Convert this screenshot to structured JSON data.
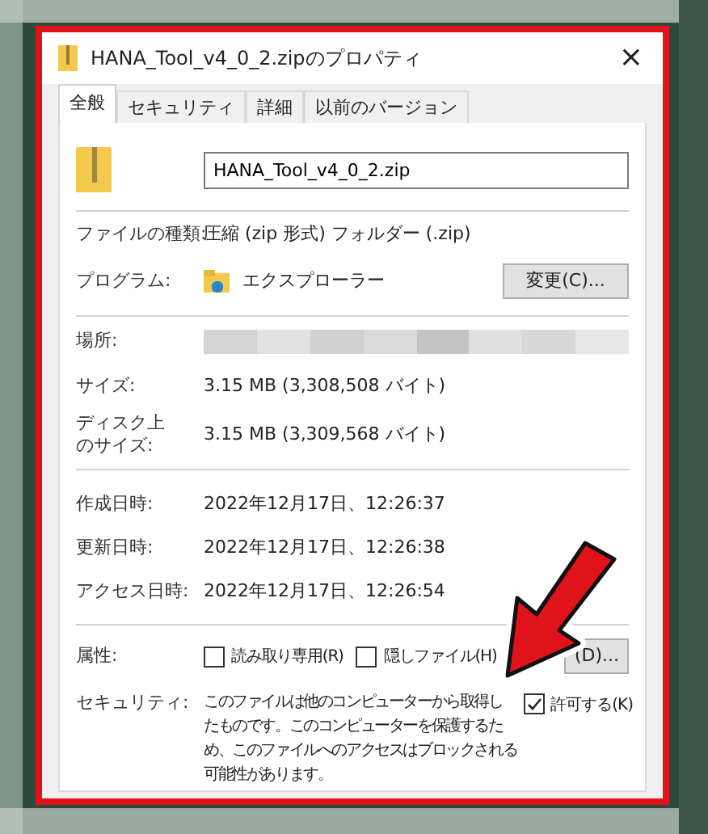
{
  "window": {
    "title": "HANA_Tool_v4_0_2.zipのプロパティ",
    "close": "×"
  },
  "tabs": [
    {
      "label": "全般",
      "selected": true
    },
    {
      "label": "セキュリティ",
      "selected": false
    },
    {
      "label": "詳細",
      "selected": false
    },
    {
      "label": "以前のバージョン",
      "selected": false
    }
  ],
  "file_name": "HANA_Tool_v4_0_2.zip",
  "file_type": {
    "label": "ファイルの種類:",
    "value": "圧縮 (zip 形式) フォルダー (.zip)"
  },
  "program": {
    "label": "プログラム:",
    "value": "エクスプローラー",
    "button": "変更(C)..."
  },
  "location": {
    "label": "場所:",
    "redacted": true
  },
  "size": {
    "label": "サイズ:",
    "value": "3.15 MB (3,308,508 バイト)"
  },
  "disk_size": {
    "label_lines": [
      "ディスク上",
      "のサイズ:"
    ],
    "value": "3.15 MB (3,309,568 バイト)"
  },
  "dates": [
    {
      "label": "作成日時:",
      "value": "2022年12月17日、12:26:37"
    },
    {
      "label": "更新日時:",
      "value": "2022年12月17日、12:26:38"
    },
    {
      "label": "アクセス日時:",
      "value": "2022年12月17日、12:26:54"
    }
  ],
  "attributes": {
    "label": "属性:",
    "options": [
      {
        "label": "読み取り専用(R)",
        "checked": false
      },
      {
        "label": "隠しファイル(H)",
        "checked": false
      }
    ],
    "button": "(D)..."
  },
  "security": {
    "label": "セキュリティ:",
    "lines": [
      "このファイルは他のコンピューターから取得し",
      "たものです。このコンピューターを保護するた",
      "め、このファイルへのアクセスはブロックされる",
      "可能性があります。"
    ],
    "unblock": {
      "label": "許可する(K)",
      "checked": true
    }
  },
  "annotation": {
    "kind": "arrow"
  }
}
